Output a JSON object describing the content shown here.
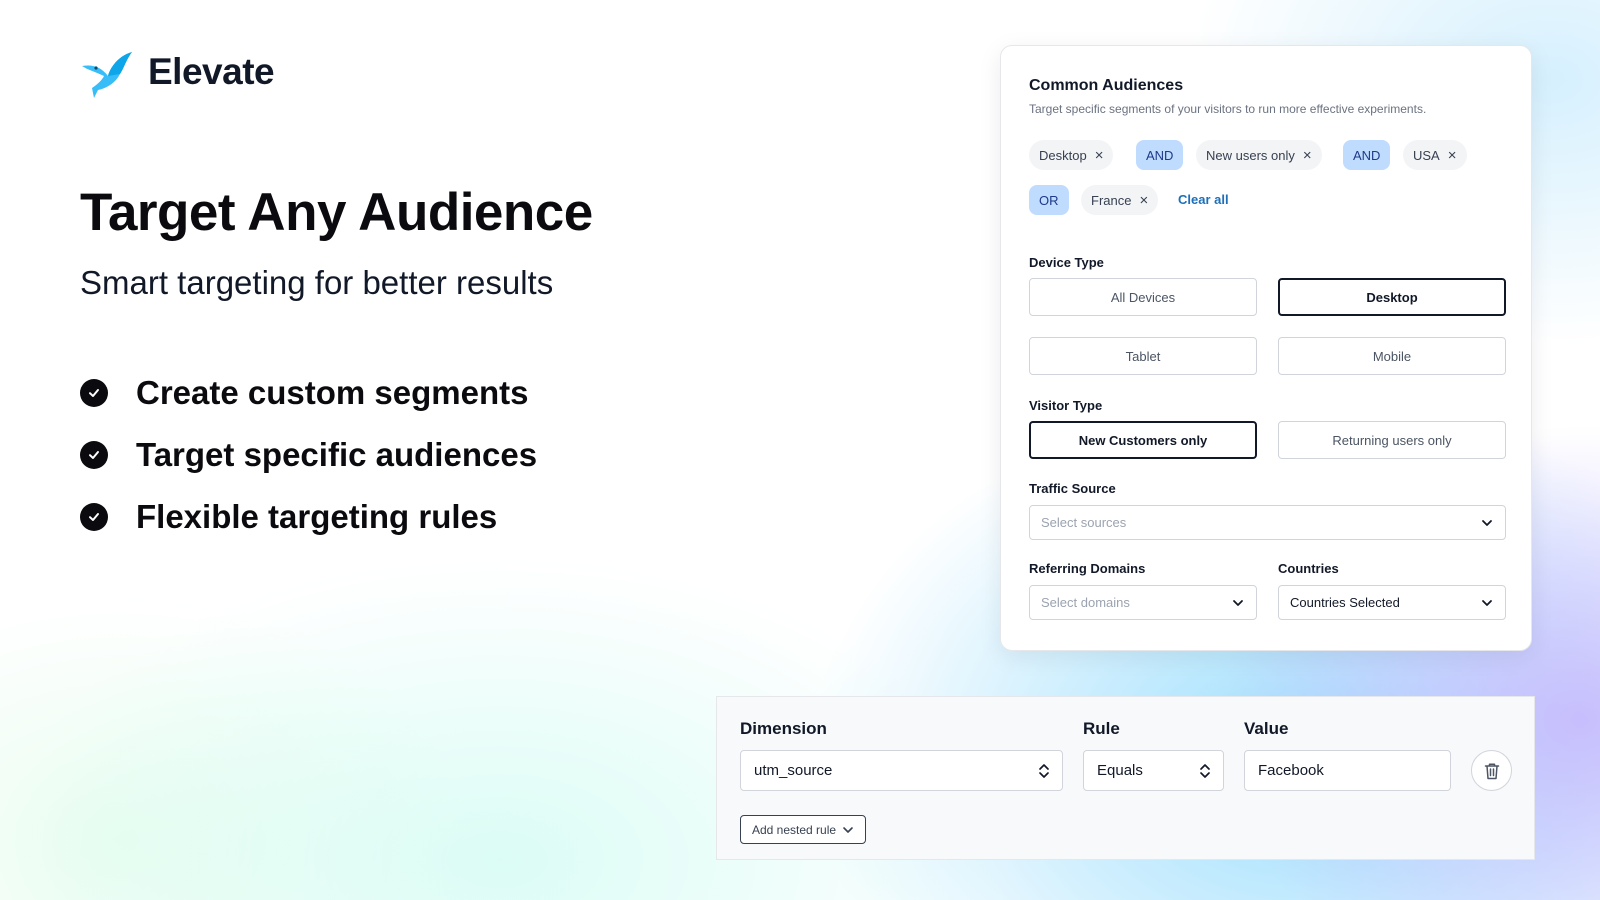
{
  "brand": {
    "name": "Elevate",
    "accent": "#38bdf8"
  },
  "hero": {
    "title": "Target Any Audience",
    "subtitle": "Smart targeting for better results",
    "features": [
      "Create custom segments",
      "Target specific audiences",
      "Flexible targeting rules"
    ]
  },
  "audiences": {
    "title": "Common Audiences",
    "description": "Target specific segments of your visitors to run more effective experiments.",
    "chips": {
      "desktop": "Desktop",
      "and1": "AND",
      "new_users": "New users only",
      "and2": "AND",
      "usa": "USA",
      "or": "OR",
      "france": "France",
      "remove_icon": "×"
    },
    "clear_all": "Clear all",
    "device_type": {
      "label": "Device Type",
      "options": [
        "All Devices",
        "Desktop",
        "Tablet",
        "Mobile"
      ],
      "selected": "Desktop"
    },
    "visitor_type": {
      "label": "Visitor Type",
      "options": [
        "New Customers only",
        "Returning users only"
      ],
      "selected": "New Customers only"
    },
    "traffic_source": {
      "label": "Traffic Source",
      "placeholder": "Select sources"
    },
    "referring_domains": {
      "label": "Referring Domains",
      "placeholder": "Select domains"
    },
    "countries": {
      "label": "Countries",
      "value": "Countries Selected"
    }
  },
  "rule_builder": {
    "dimension_label": "Dimension",
    "rule_label": "Rule",
    "value_label": "Value",
    "dimension_value": "utm_source",
    "rule_value": "Equals",
    "value_value": "Facebook",
    "add_nested_rule": "Add nested rule"
  }
}
